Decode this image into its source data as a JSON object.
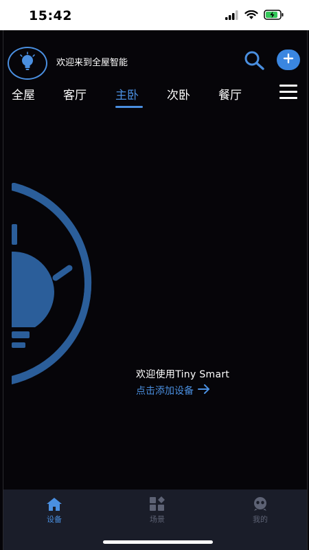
{
  "status_bar": {
    "time": "15:42",
    "icons": [
      "cellular-signal-icon",
      "wifi-icon",
      "battery-charging-icon"
    ]
  },
  "header": {
    "welcome": "欢迎来到全屋智能",
    "logo_icon": "lightbulb-icon",
    "search_icon": "search-icon",
    "add_icon": "plus-icon"
  },
  "rooms": {
    "tabs": [
      "全屋",
      "客厅",
      "主卧",
      "次卧",
      "餐厅"
    ],
    "active": "主卧",
    "menu_icon": "hamburger-menu-icon"
  },
  "main": {
    "welcome_text": "欢迎使用Tiny Smart",
    "add_device_link": "点击添加设备",
    "hero_icon": "lightbulb-illustration-icon"
  },
  "bottom_nav": {
    "items": [
      {
        "label": "设备",
        "icon": "home-icon",
        "active": true
      },
      {
        "label": "场景",
        "icon": "scene-grid-icon",
        "active": false
      },
      {
        "label": "我的",
        "icon": "profile-icon",
        "active": false
      }
    ]
  },
  "colors": {
    "accent": "#4a8fe0",
    "background": "#060509",
    "nav_background": "#1a1d29",
    "hero_blue": "#2b5e9a"
  }
}
